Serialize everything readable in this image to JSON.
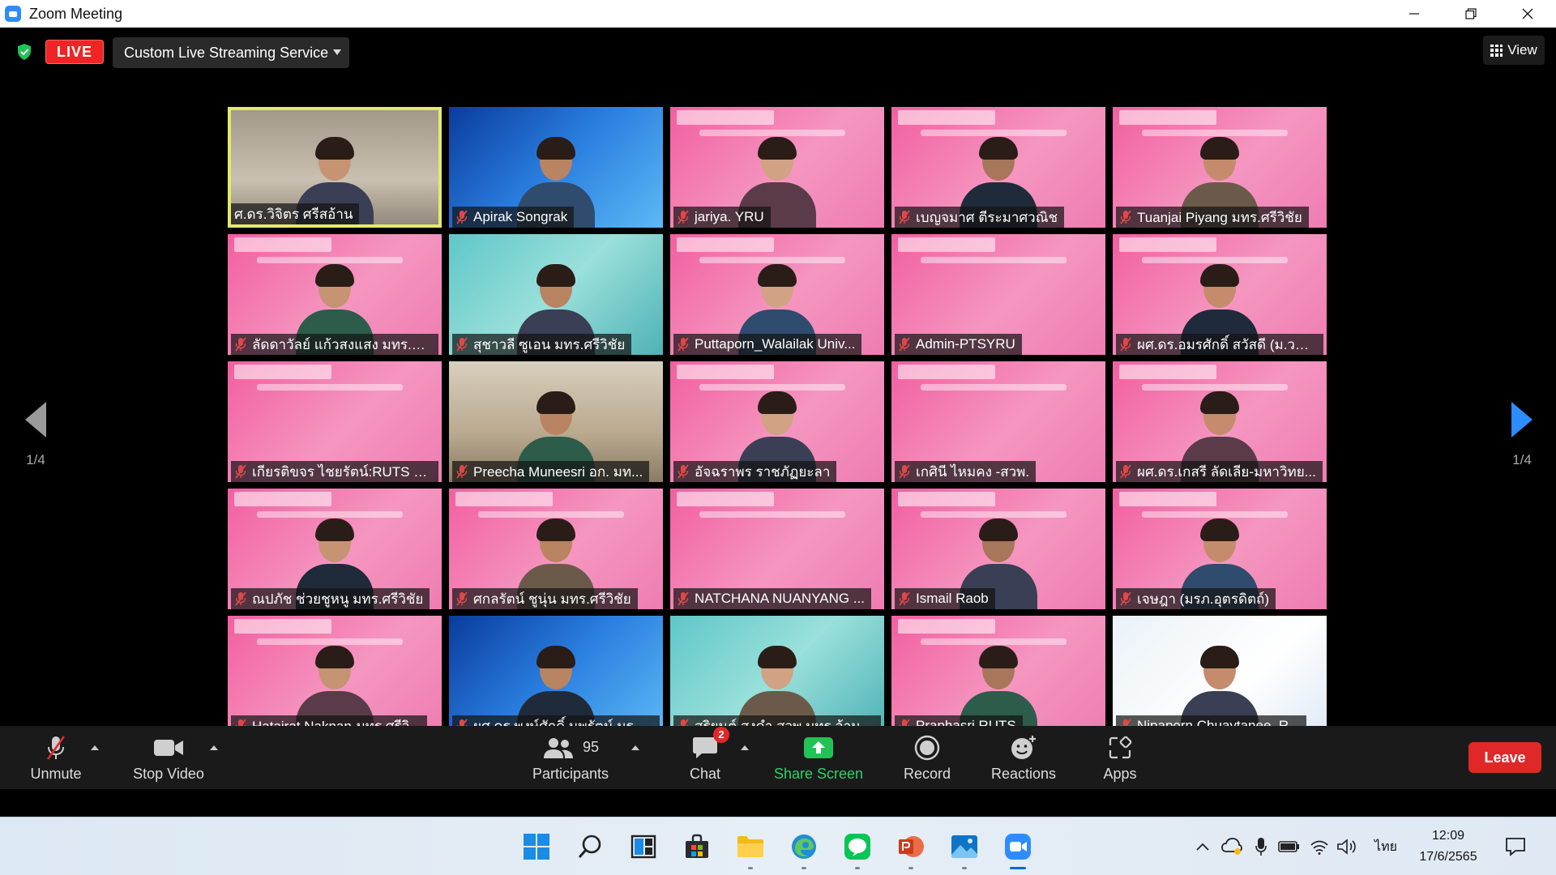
{
  "window": {
    "title": "Zoom Meeting"
  },
  "topbar": {
    "live_label": "LIVE",
    "stream_service": "Custom Live Streaming Service",
    "view_label": "View"
  },
  "paging": {
    "left_page": "1/4",
    "right_page": "1/4"
  },
  "participants": [
    {
      "name": "ศ.ดร.วิจิตร ศรีสอ้าน",
      "bg": "room",
      "active": true,
      "muted": false
    },
    {
      "name": "Apirak Songrak",
      "bg": "blue",
      "muted": true
    },
    {
      "name": "jariya. YRU",
      "bg": "pink",
      "muted": true
    },
    {
      "name": "เบญจมาศ ตีระมาศวณิช",
      "bg": "pink",
      "muted": true
    },
    {
      "name": "Tuanjai  Piyang มทร.ศรีวิชัย",
      "bg": "pink",
      "muted": true
    },
    {
      "name": "ลัดดาวัลย์ แก้วสงแสง มทร.ศรีวิ...",
      "bg": "pink",
      "muted": true
    },
    {
      "name": "สุชาวลี ซูเอน มทร.ศรีวิชัย",
      "bg": "teal",
      "muted": true
    },
    {
      "name": "Puttaporn_Walailak Univ...",
      "bg": "pink",
      "muted": true
    },
    {
      "name": "Admin-PTSYRU",
      "bg": "pink",
      "muted": true,
      "empty": true
    },
    {
      "name": "ผศ.ดร.อมรศักดิ์ สวัสดี (ม.วลัย...",
      "bg": "pink",
      "muted": true
    },
    {
      "name": "เกียรติขจร ไชยรัตน์:RUTS Sa...",
      "bg": "pink",
      "muted": true,
      "empty": true
    },
    {
      "name": "Preecha Muneesri อก. มท...",
      "bg": "cafe",
      "muted": true
    },
    {
      "name": "อัจฉราพร ราชภัฏยะลา",
      "bg": "pink",
      "muted": true
    },
    {
      "name": "เกศินี ไหมคง -สวพ.",
      "bg": "pink",
      "muted": true,
      "empty": true
    },
    {
      "name": "ผศ.ดร.เกสรี ลัดเลีย-มหาวิทย...",
      "bg": "pink",
      "muted": true
    },
    {
      "name": "ณปภัช ช่วยชูหนู มทร.ศรีวิชัย",
      "bg": "pink",
      "muted": true
    },
    {
      "name": "ศกลรัตน์ ชูนุ่น มทร.ศรีวิชัย",
      "bg": "pink",
      "muted": true
    },
    {
      "name": "NATCHANA NUANYANG ...",
      "bg": "pink",
      "muted": true,
      "empty": true
    },
    {
      "name": "Ismail Raob",
      "bg": "pink",
      "muted": true
    },
    {
      "name": "เจษฎา (มรภ.อุตรดิตถ์)",
      "bg": "pink",
      "muted": true
    },
    {
      "name": "Hatairat Naknan-มทร.ศรีวิ...",
      "bg": "pink",
      "muted": true
    },
    {
      "name": "ผศ.ดร.พงษ์ศักดิ์ นพรัตน์ มรภ....",
      "bg": "blue",
      "muted": true
    },
    {
      "name": "สุริยนต์ สูงคำ สวพ.มทร.ล้านนา",
      "bg": "teal",
      "muted": true
    },
    {
      "name": "Praphasri RUTS",
      "bg": "pink",
      "muted": true
    },
    {
      "name": "Nipaporn Chuaytanee_R...",
      "bg": "light",
      "muted": true
    }
  ],
  "toolbar": {
    "unmute": "Unmute",
    "stop_video": "Stop Video",
    "participants": "Participants",
    "participants_count": "95",
    "chat": "Chat",
    "chat_badge": "2",
    "share_screen": "Share Screen",
    "record": "Record",
    "reactions": "Reactions",
    "apps": "Apps",
    "leave": "Leave"
  },
  "taskbar": {
    "language": "ไทย",
    "time": "12:09",
    "date": "17/6/2565"
  },
  "colors": {
    "zoom_blue": "#2D8CFF",
    "live_red": "#F02424",
    "leave_red": "#E02828",
    "share_green": "#2AD26B",
    "active_speaker": "#E3EA6A"
  }
}
